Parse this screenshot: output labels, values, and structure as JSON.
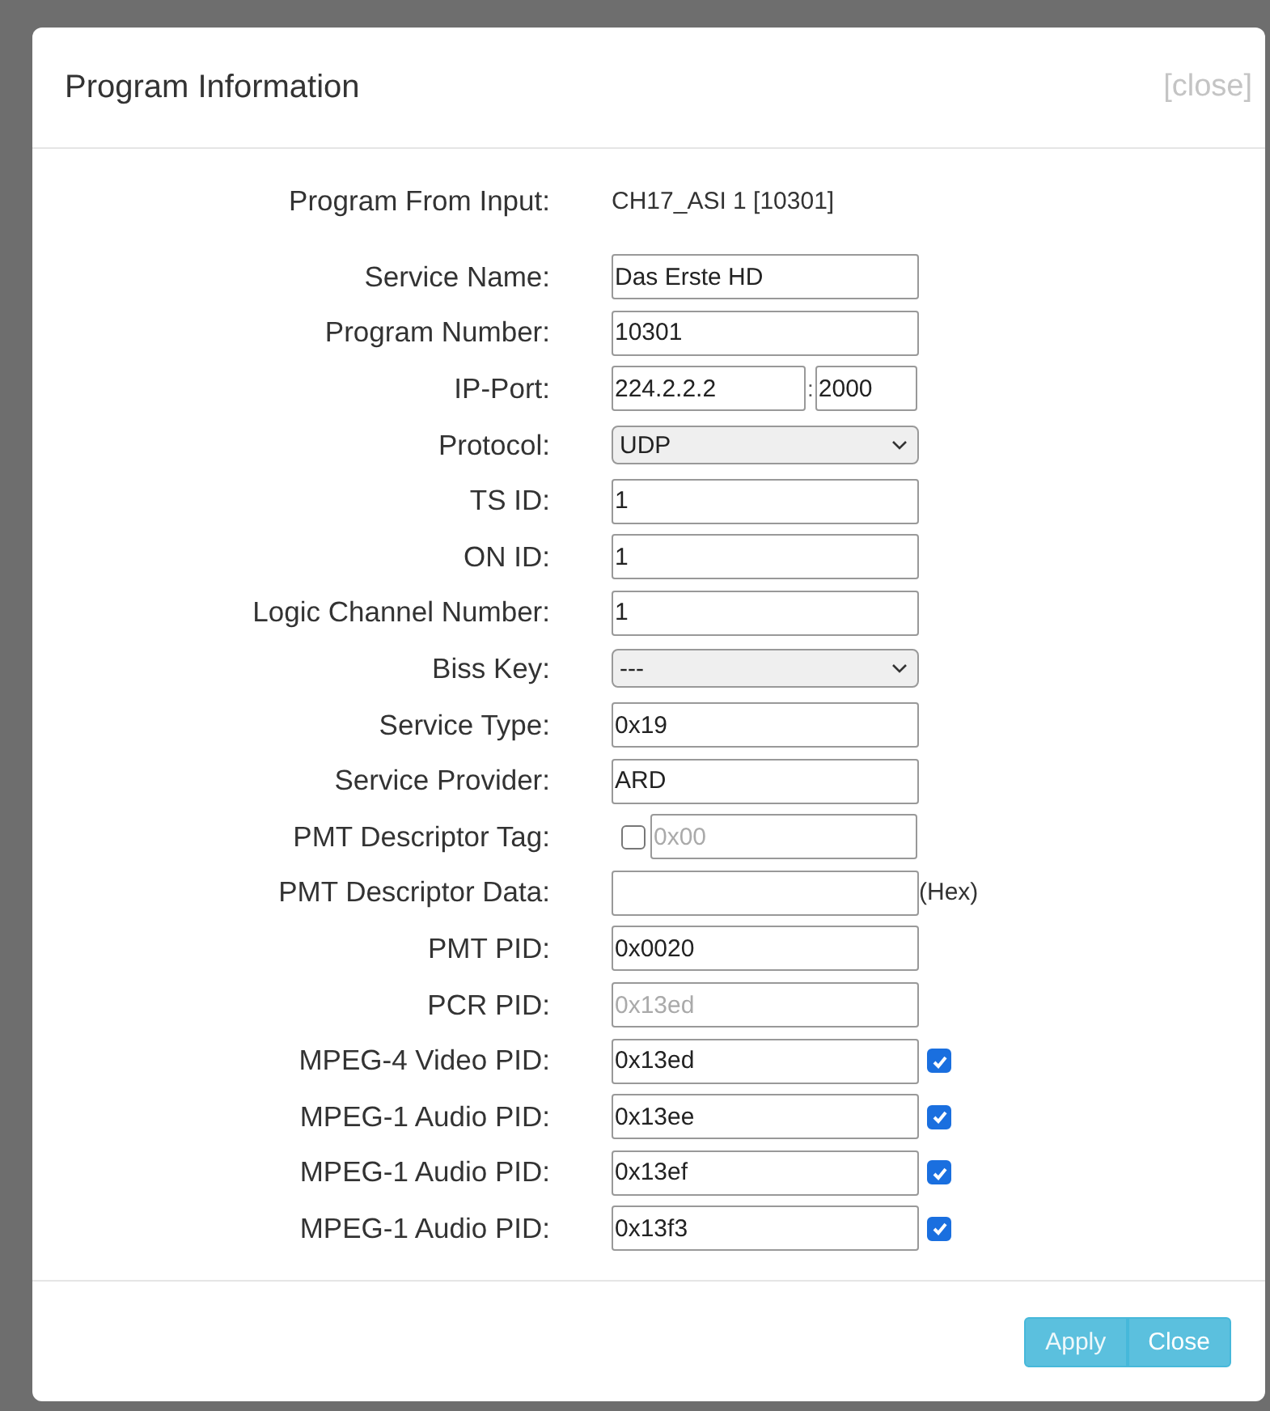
{
  "dialog": {
    "title": "Program Information",
    "close_link": "[close]"
  },
  "rows": [
    {
      "label": "Program From Input:",
      "kind": "text",
      "value": "CH17_ASI 1 [10301]"
    },
    {
      "label": "Service Name:",
      "kind": "input",
      "value": "Das Erste HD"
    },
    {
      "label": "Program Number:",
      "kind": "input",
      "value": "10301"
    },
    {
      "label": "IP-Port:",
      "kind": "ip-port",
      "value": "224.2.2.2",
      "separator": ":",
      "port": "2000"
    },
    {
      "label": "Protocol:",
      "kind": "select",
      "value": "UDP"
    },
    {
      "label": "TS ID:",
      "kind": "input",
      "value": "1"
    },
    {
      "label": "ON ID:",
      "kind": "input",
      "value": "1"
    },
    {
      "label": "Logic Channel Number:",
      "kind": "input",
      "value": "1"
    },
    {
      "label": "Biss Key:",
      "kind": "select",
      "value": "---"
    },
    {
      "label": "Service Type:",
      "kind": "input",
      "value": "0x19"
    },
    {
      "label": "Service Provider:",
      "kind": "input",
      "value": "ARD"
    },
    {
      "label": "PMT Descriptor Tag:",
      "kind": "check-input",
      "checked": false,
      "value": "0x00",
      "disabled": true
    },
    {
      "label": "PMT Descriptor Data:",
      "kind": "input",
      "value": "",
      "suffix": "(Hex)"
    },
    {
      "label": "PMT PID:",
      "kind": "input",
      "value": "0x0020"
    },
    {
      "label": "PCR PID:",
      "kind": "input",
      "value": "0x13ed",
      "disabled": true
    },
    {
      "label": "MPEG-4 Video PID:",
      "kind": "input-check",
      "value": "0x13ed",
      "checked": true
    },
    {
      "label": "MPEG-1 Audio PID:",
      "kind": "input-check",
      "value": "0x13ee",
      "checked": true
    },
    {
      "label": "MPEG-1 Audio PID:",
      "kind": "input-check",
      "value": "0x13ef",
      "checked": true
    },
    {
      "label": "MPEG-1 Audio PID:",
      "kind": "input-check",
      "value": "0x13f3",
      "checked": true
    }
  ],
  "buttons": [
    {
      "label": "Apply"
    },
    {
      "label": "Close"
    }
  ]
}
